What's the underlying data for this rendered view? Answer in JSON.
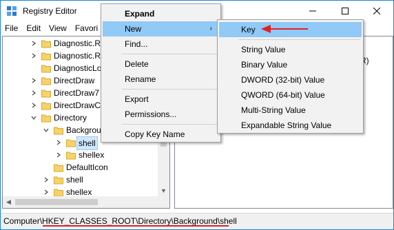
{
  "window": {
    "title": "Registry Editor",
    "minimize_glyph": "—",
    "maximize_glyph": "☐",
    "close_glyph": "✕"
  },
  "menubar": [
    "File",
    "Edit",
    "View",
    "Favori"
  ],
  "tree": {
    "items": [
      {
        "label": "Diagnostic.R",
        "level": 0,
        "expander": "collapsed"
      },
      {
        "label": "Diagnostic.R",
        "level": 0,
        "expander": "collapsed"
      },
      {
        "label": "DiagnosticLo",
        "level": 0,
        "expander": "none"
      },
      {
        "label": "DirectDraw",
        "level": 0,
        "expander": "collapsed"
      },
      {
        "label": "DirectDraw7",
        "level": 0,
        "expander": "collapsed"
      },
      {
        "label": "DirectDrawC",
        "level": 0,
        "expander": "collapsed"
      },
      {
        "label": "Directory",
        "level": 0,
        "expander": "expanded"
      },
      {
        "label": "Backgrou",
        "level": 1,
        "expander": "expanded"
      },
      {
        "label": "shell",
        "level": 2,
        "expander": "collapsed",
        "selected": true
      },
      {
        "label": "shellex",
        "level": 2,
        "expander": "collapsed"
      },
      {
        "label": "DefaultIcon",
        "level": 1,
        "expander": "none"
      },
      {
        "label": "shell",
        "level": 1,
        "expander": "collapsed"
      },
      {
        "label": "shellex",
        "level": 1,
        "expander": "collapsed"
      }
    ]
  },
  "right_pane": {
    "visible_text": "R)"
  },
  "status": {
    "path": "Computer\\HKEY_CLASSES_ROOT\\Directory\\Background\\shell"
  },
  "context_menu": {
    "items": [
      {
        "label": "Expand",
        "bold": true
      },
      {
        "label": "New",
        "submenu": true,
        "highlighted": true
      },
      {
        "label": "Find..."
      },
      {
        "separator": true
      },
      {
        "label": "Delete"
      },
      {
        "label": "Rename"
      },
      {
        "separator": true
      },
      {
        "label": "Export"
      },
      {
        "label": "Permissions..."
      },
      {
        "separator": true
      },
      {
        "label": "Copy Key Name"
      }
    ],
    "submenu_arrow": "›"
  },
  "new_submenu": {
    "items": [
      {
        "label": "Key",
        "highlighted": true
      },
      {
        "separator": true
      },
      {
        "label": "String Value"
      },
      {
        "label": "Binary Value"
      },
      {
        "label": "DWORD (32-bit) Value"
      },
      {
        "label": "QWORD (64-bit) Value"
      },
      {
        "label": "Multi-String Value"
      },
      {
        "label": "Expandable String Value"
      }
    ]
  },
  "colors": {
    "highlight": "#91c9f7",
    "annotation_red": "#e02020",
    "folder": "#f6d26a",
    "window_border": "#1883d7"
  },
  "icons": {
    "app": "registry-editor-icon",
    "folder": "folder-icon"
  }
}
